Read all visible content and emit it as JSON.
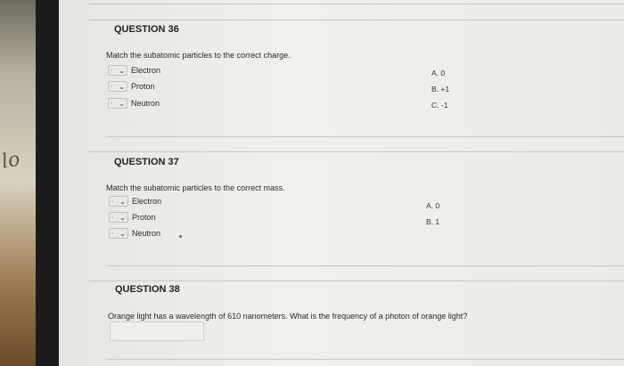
{
  "q36": {
    "title": "QUESTION 36",
    "prompt": "Match the subatomic particles to the correct charge.",
    "items": [
      "Electron",
      "Proton",
      "Neutron"
    ],
    "options": [
      "A. 0",
      "B. +1",
      "C. -1"
    ]
  },
  "q37": {
    "title": "QUESTION 37",
    "prompt": "Match the subatomic particles to the correct mass.",
    "items": [
      "Electron",
      "Proton",
      "Neutron"
    ],
    "options": [
      "A. 0",
      "B. 1"
    ]
  },
  "q38": {
    "title": "QUESTION 38",
    "prompt": "Orange light has a wavelength of 610 nanometers. What is the frequency of a photon of orange light?",
    "answer_value": ""
  },
  "icons": {
    "dropdown": "chevron-down-icon",
    "dash": "-",
    "chevron": "⌄"
  },
  "background_text": "lo"
}
